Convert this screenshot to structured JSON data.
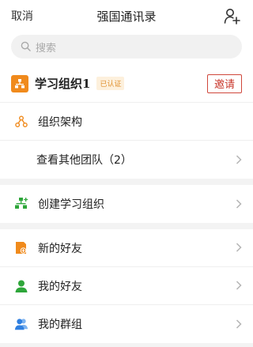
{
  "header": {
    "cancel_label": "取消",
    "title": "强国通讯录",
    "add_user_icon": "add-user-icon"
  },
  "search": {
    "placeholder": "搜索",
    "icon": "search-icon"
  },
  "org": {
    "name": "学习组织1",
    "badge": "已认证",
    "invite_label": "邀请",
    "icon": "org-chart-icon"
  },
  "structure": {
    "label": "组织架构",
    "icon": "hierarchy-icon"
  },
  "other_teams": {
    "label": "查看其他团队（2）"
  },
  "create_org": {
    "label": "创建学习组织",
    "icon": "create-org-icon"
  },
  "contacts": [
    {
      "label": "新的好友",
      "icon": "new-friend-icon"
    },
    {
      "label": "我的好友",
      "icon": "friend-icon"
    },
    {
      "label": "我的群组",
      "icon": "group-icon"
    }
  ],
  "colors": {
    "accent_orange": "#f08a1c",
    "invite_red": "#c8362a",
    "green": "#2ea63a",
    "blue": "#2f7fe0"
  }
}
